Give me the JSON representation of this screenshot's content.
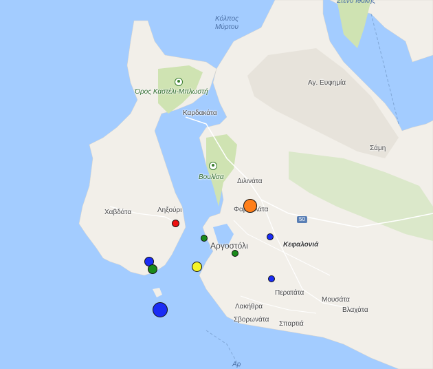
{
  "labels": {
    "gulf": "Κόλπος\nΜύρτου",
    "strait": "Στενό Ιθάκης",
    "mountain": "Όρος Καστέλι-Μπλωστή",
    "vouleisa": "Βουλίσα",
    "kardakata": "Καρδακάτα",
    "ag_eufimia": "Αγ. Ευφημία",
    "sami": "Σάμη",
    "dilinata": "Διλινάτα",
    "fakata": "Φαρακλάτα",
    "havdata": "Χαβδάτα",
    "lixouri": "Ληξούρι",
    "argostoli": "Αργοστόλι",
    "kefalonia": "Κεφαλονιά",
    "peratata": "Περατάτα",
    "mousata": "Μουσάτα",
    "vlahata": "Βλαχάτα",
    "lakithra": "Λακήθρα",
    "svoronata": "Σβορωνάτα",
    "spartia": "Σπαρτιά",
    "route": "50",
    "bottom_water": "Αρ"
  },
  "poi_icons": [
    "park-icon",
    "park-icon"
  ],
  "earthquakes": [
    {
      "id": "quake-orange",
      "color": "#ff7f1a"
    },
    {
      "id": "quake-red",
      "color": "#ee1111"
    },
    {
      "id": "quake-green-1",
      "color": "#1a8a1a"
    },
    {
      "id": "quake-blue-1",
      "color": "#1a2cf5"
    },
    {
      "id": "quake-green-2",
      "color": "#1a8a1a"
    },
    {
      "id": "quake-blue-2",
      "color": "#1a2cf5"
    },
    {
      "id": "quake-green-3",
      "color": "#1a8a1a"
    },
    {
      "id": "quake-yellow",
      "color": "#f5f528"
    },
    {
      "id": "quake-blue-3",
      "color": "#1a2cf5"
    },
    {
      "id": "quake-blue-big",
      "color": "#1a2cf5"
    }
  ],
  "colors": {
    "sea": "#a3ccff",
    "land": "#f2efe9",
    "forest": "#cfe3b2",
    "hill": "#e2ded4"
  }
}
